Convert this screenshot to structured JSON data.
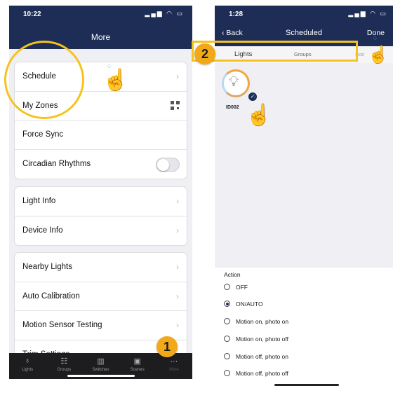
{
  "left_phone": {
    "status": {
      "time": "10:22",
      "icons": "▂▄▆ ◠ ▭"
    },
    "nav_title": "More",
    "groups": [
      [
        {
          "label": "Schedule",
          "accessory": "chevron"
        },
        {
          "label": "My Zones",
          "accessory": "qr"
        },
        {
          "label": "Force Sync",
          "accessory": "none"
        },
        {
          "label": "Circadian Rhythms",
          "accessory": "toggle",
          "toggle_on": false
        }
      ],
      [
        {
          "label": "Light Info",
          "accessory": "chevron"
        },
        {
          "label": "Device Info",
          "accessory": "chevron"
        }
      ],
      [
        {
          "label": "Nearby Lights",
          "accessory": "chevron"
        },
        {
          "label": "Auto Calibration",
          "accessory": "chevron"
        },
        {
          "label": "Motion Sensor Testing",
          "accessory": "chevron"
        },
        {
          "label": "Trim Settings",
          "accessory": "chevron"
        }
      ]
    ],
    "tabbar": [
      {
        "label": "Lights",
        "icon": "bulb-icon",
        "glyph": "♁"
      },
      {
        "label": "Groups",
        "icon": "groups-icon",
        "glyph": "☷"
      },
      {
        "label": "Switches",
        "icon": "switches-icon",
        "glyph": "▥"
      },
      {
        "label": "Scenes",
        "icon": "scenes-icon",
        "glyph": "▣"
      },
      {
        "label": "More",
        "icon": "more-icon",
        "glyph": "⋯",
        "active": true
      }
    ],
    "step_badge": "1"
  },
  "right_phone": {
    "status": {
      "time": "1:28",
      "icons": "▂▄▆ ◠ ▭"
    },
    "back_label": "‹ Back",
    "title": "Scheduled",
    "done_label": "Done",
    "segments": [
      "Lights",
      "Groups",
      "Sce"
    ],
    "light": {
      "label": "ID002",
      "selected": true
    },
    "action_label": "Action",
    "options": [
      {
        "label": "OFF",
        "selected": false
      },
      {
        "label": "ON/AUTO",
        "selected": true
      },
      {
        "label": "Motion on, photo on",
        "selected": false
      },
      {
        "label": "Motion on, photo off",
        "selected": false
      },
      {
        "label": "Motion off, photo on",
        "selected": false
      },
      {
        "label": "Motion off, photo off",
        "selected": false
      }
    ],
    "step_badge": "2"
  },
  "colors": {
    "navy": "#1d2d55",
    "highlight": "#f6c21f",
    "badge": "#f1a91a"
  }
}
